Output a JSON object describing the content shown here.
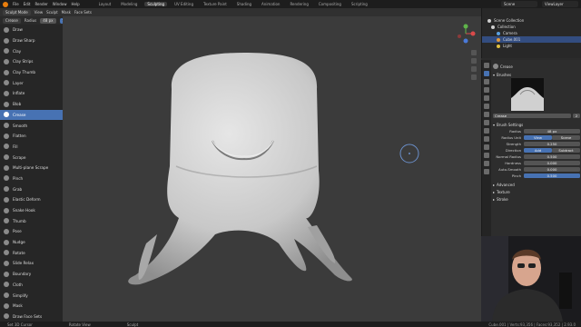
{
  "topbar": {
    "menus": [
      "File",
      "Edit",
      "Render",
      "Window",
      "Help"
    ],
    "workspaces": [
      "Layout",
      "Modeling",
      "Sculpting",
      "UV Editing",
      "Texture Paint",
      "Shading",
      "Animation",
      "Rendering",
      "Compositing",
      "Scripting"
    ],
    "active_workspace": "Sculpting",
    "scene": "Scene",
    "view_layer": "ViewLayer"
  },
  "tool_header": {
    "mode": "Sculpt Mode",
    "view": "View",
    "sculpt": "Sculpt",
    "mask": "Mask",
    "face_sets": "Face Sets",
    "brush_label": "Crease",
    "radius_label": "Radius",
    "radius_value": "48 px",
    "strength_label": "Strength",
    "strength_value": "0.250",
    "brush_menu": "Brush",
    "texture_menu": "Texture",
    "stroke_menu": "Stroke",
    "falloff_menu": "Falloff",
    "cursor_menu": "Cursor",
    "dyntopo": "Dyntopo",
    "remesh": "Remesh",
    "options": "Options"
  },
  "sidebar": {
    "items": [
      {
        "label": "Draw"
      },
      {
        "label": "Draw Sharp"
      },
      {
        "label": "Clay"
      },
      {
        "label": "Clay Strips"
      },
      {
        "label": "Clay Thumb"
      },
      {
        "label": "Layer"
      },
      {
        "label": "Inflate"
      },
      {
        "label": "Blob"
      },
      {
        "label": "Crease"
      },
      {
        "label": "Smooth"
      },
      {
        "label": "Flatten"
      },
      {
        "label": "Fill"
      },
      {
        "label": "Scrape"
      },
      {
        "label": "Multi-plane Scrape"
      },
      {
        "label": "Pinch"
      },
      {
        "label": "Grab"
      },
      {
        "label": "Elastic Deform"
      },
      {
        "label": "Snake Hook"
      },
      {
        "label": "Thumb"
      },
      {
        "label": "Pose"
      },
      {
        "label": "Nudge"
      },
      {
        "label": "Rotate"
      },
      {
        "label": "Slide Relax"
      },
      {
        "label": "Boundary"
      },
      {
        "label": "Cloth"
      },
      {
        "label": "Simplify"
      },
      {
        "label": "Mask"
      },
      {
        "label": "Draw Face Sets"
      }
    ],
    "active_index": 8
  },
  "outliner": {
    "rows": [
      {
        "label": "Scene Collection",
        "color": "#cfcfcf"
      },
      {
        "label": "Collection",
        "color": "#cfcfcf"
      },
      {
        "label": "Camera",
        "color": "#5aa0e0"
      },
      {
        "label": "Cube.001",
        "color": "#e09a3c"
      },
      {
        "label": "Light",
        "color": "#e0c040"
      }
    ],
    "selected_index": 3
  },
  "properties": {
    "tool_name": "Crease",
    "brushes_header": "Brushes",
    "brush_name": "Crease",
    "brush_users": "2",
    "brush_settings_header": "Brush Settings",
    "radius_label": "Radius",
    "radius_value": "48 px",
    "radius_unit_label": "Radius Unit",
    "radius_unit_view": "View",
    "radius_unit_scene": "Scene",
    "strength_label": "Strength",
    "strength_value": "0.250",
    "direction_label": "Direction",
    "direction_add": "Add",
    "direction_subtract": "Subtract",
    "normal_radius_label": "Normal Radius",
    "normal_radius_value": "0.500",
    "hardness_label": "Hardness",
    "hardness_value": "0.000",
    "auto_smooth_label": "Auto-Smooth",
    "auto_smooth_value": "0.000",
    "pinch_label": "Pinch",
    "pinch_value": "0.500",
    "advanced": "Advanced",
    "texture": "Texture",
    "stroke": "Stroke"
  },
  "statusbar": {
    "left": "Set 3D Cursor",
    "middle": "Rotate View",
    "right": "Sculpt",
    "stats": "Cube.001 | Verts:93,356 | Faces:93,352 | 2.93.0"
  },
  "colors": {
    "accent": "#4772b3",
    "viewport": "#3b3b3b",
    "sculpt_surface": "#d4d4d4"
  }
}
